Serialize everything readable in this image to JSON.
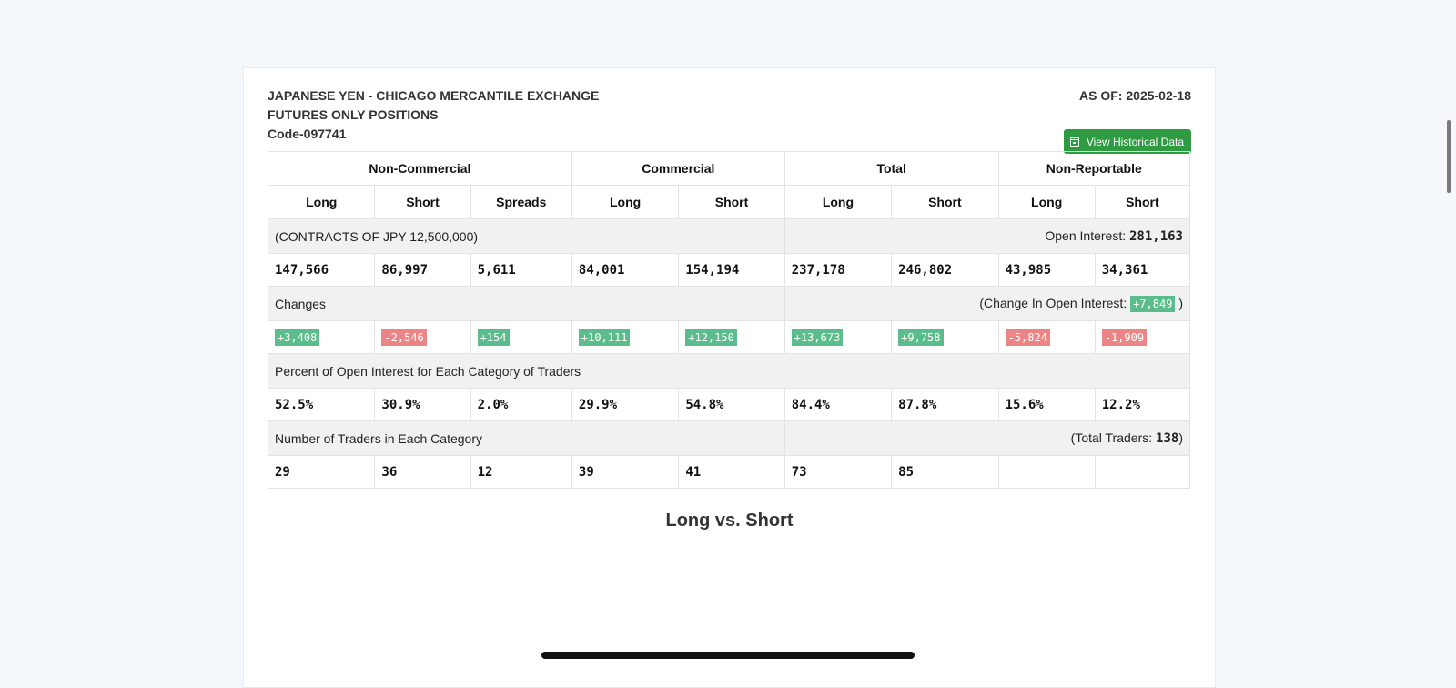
{
  "header": {
    "title_line1": "JAPANESE YEN - CHICAGO MERCANTILE EXCHANGE",
    "title_line2": "FUTURES ONLY POSITIONS",
    "code": "Code-097741",
    "as_of_label": "AS OF:",
    "as_of_date": "2025-02-18",
    "history_button": "View Historical Data"
  },
  "groups": [
    "Non-Commercial",
    "Commercial",
    "Total",
    "Non-Reportable"
  ],
  "columns": [
    "Long",
    "Short",
    "Spreads",
    "Long",
    "Short",
    "Long",
    "Short",
    "Long",
    "Short"
  ],
  "contracts": {
    "label": "(CONTRACTS OF JPY 12,500,000)",
    "oi_label": "Open Interest:",
    "oi_value": "281,163",
    "values": [
      "147,566",
      "86,997",
      "5,611",
      "84,001",
      "154,194",
      "237,178",
      "246,802",
      "43,985",
      "34,361"
    ]
  },
  "changes": {
    "label": "Changes",
    "oi_prefix": "(Change In Open Interest:",
    "oi_value": "+7,849",
    "oi_suffix": ")",
    "values": [
      "+3,408",
      "-2,546",
      "+154",
      "+10,111",
      "+12,150",
      "+13,673",
      "+9,758",
      "-5,824",
      "-1,909"
    ]
  },
  "percent": {
    "label": "Percent of Open Interest for Each Category of Traders",
    "values": [
      "52.5%",
      "30.9%",
      "2.0%",
      "29.9%",
      "54.8%",
      "84.4%",
      "87.8%",
      "15.6%",
      "12.2%"
    ]
  },
  "traders": {
    "label": "Number of Traders in Each Category",
    "total_prefix": "(Total Traders:",
    "total_value": "138",
    "total_suffix": ")",
    "values": [
      "29",
      "36",
      "12",
      "39",
      "41",
      "73",
      "85",
      "",
      ""
    ]
  },
  "chart": {
    "title": "Long vs. Short"
  },
  "colors": {
    "button": "#2e9b43",
    "positive": "#5bbd8c",
    "negative": "#ec8585"
  }
}
